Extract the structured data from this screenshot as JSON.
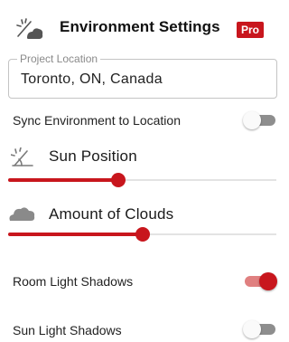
{
  "header": {
    "icon": "sun-cloud-icon",
    "title": "Environment Settings",
    "badge": "Pro"
  },
  "location": {
    "label": "Project Location",
    "value": "Toronto, ON, Canada"
  },
  "sync": {
    "label": "Sync Environment to Location",
    "enabled": false
  },
  "sun_position": {
    "icon": "sun-angle-icon",
    "title": "Sun Position",
    "value_fraction": 0.41
  },
  "clouds": {
    "icon": "cloud-icon",
    "title": "Amount of Clouds",
    "value_fraction": 0.5
  },
  "room_light_shadows": {
    "label": "Room Light Shadows",
    "enabled": true
  },
  "sun_light_shadows": {
    "label": "Sun Light Shadows",
    "enabled": false
  },
  "colors": {
    "accent": "#c8161d",
    "toggle_on_track": "#e08080",
    "toggle_off_track": "#8e8e8e",
    "rail": "#e3e3e3"
  }
}
